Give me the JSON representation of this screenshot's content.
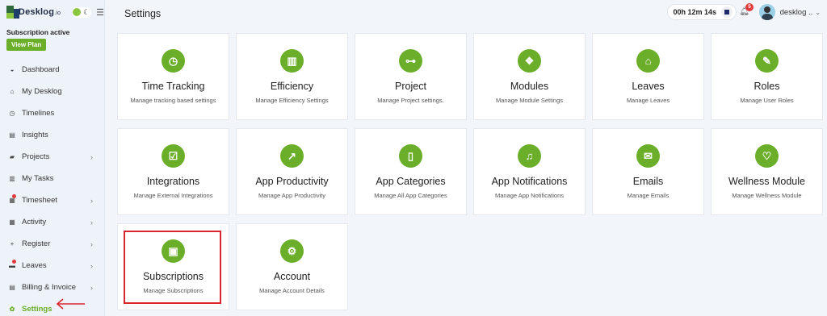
{
  "app": {
    "logo_text": "Desklog",
    "logo_suffix": ".io",
    "subscription_status": "Subscription active",
    "view_plan_label": "View Plan"
  },
  "sidebar": {
    "items": [
      {
        "label": "Dashboard",
        "icon": "dashboard-icon",
        "glyph": "◒",
        "chevron": "",
        "dot": false,
        "active": false
      },
      {
        "label": "My Desklog",
        "icon": "home-icon",
        "glyph": "⌂",
        "chevron": "",
        "dot": false,
        "active": false
      },
      {
        "label": "Timelines",
        "icon": "clock-icon",
        "glyph": "◷",
        "chevron": "",
        "dot": false,
        "active": false
      },
      {
        "label": "Insights",
        "icon": "book-icon",
        "glyph": "▤",
        "chevron": "",
        "dot": false,
        "active": false
      },
      {
        "label": "Projects",
        "icon": "folder-icon",
        "glyph": "▰",
        "chevron": "›",
        "dot": false,
        "active": false
      },
      {
        "label": "My Tasks",
        "icon": "tasks-icon",
        "glyph": "▥",
        "chevron": "",
        "dot": false,
        "active": false
      },
      {
        "label": "Timesheet",
        "icon": "timesheet-icon",
        "glyph": "▦",
        "chevron": "›",
        "dot": true,
        "active": false
      },
      {
        "label": "Activity",
        "icon": "activity-icon",
        "glyph": "▦",
        "chevron": "›",
        "dot": false,
        "active": false
      },
      {
        "label": "Register",
        "icon": "plus-icon",
        "glyph": "+",
        "chevron": "›",
        "dot": false,
        "active": false
      },
      {
        "label": "Leaves",
        "icon": "leaves-icon",
        "glyph": "▬",
        "chevron": "›",
        "dot": true,
        "active": false
      },
      {
        "label": "Billing & Invoice",
        "icon": "billing-icon",
        "glyph": "▤",
        "chevron": "›",
        "dot": false,
        "active": false
      },
      {
        "label": "Settings",
        "icon": "gear-icon",
        "glyph": "✿",
        "chevron": "",
        "dot": false,
        "active": true
      }
    ]
  },
  "header": {
    "title": "Settings",
    "timer": "00h 12m 14s",
    "notification_count": "5",
    "user_name": "desklog ..",
    "user_chevron": "⌄"
  },
  "cards": [
    {
      "title": "Time Tracking",
      "desc": "Manage tracking based settings",
      "icon": "clock-icon",
      "glyph": "◷"
    },
    {
      "title": "Efficiency",
      "desc": "Manage Efficiency Settings",
      "icon": "bar-chart-icon",
      "glyph": "▥"
    },
    {
      "title": "Project",
      "desc": "Manage Project settings.",
      "icon": "sitemap-icon",
      "glyph": "⊶"
    },
    {
      "title": "Modules",
      "desc": "Manage Module Settings",
      "icon": "cubes-icon",
      "glyph": "❖"
    },
    {
      "title": "Leaves",
      "desc": "Manage Leaves",
      "icon": "home-icon",
      "glyph": "⌂"
    },
    {
      "title": "Roles",
      "desc": "Manage User Roles",
      "icon": "wrench-icon",
      "glyph": "✎"
    },
    {
      "title": "Integrations",
      "desc": "Manage External Integrations",
      "icon": "checkbox-icon",
      "glyph": "☑"
    },
    {
      "title": "App Productivity",
      "desc": "Manage App Productivity",
      "icon": "line-chart-icon",
      "glyph": "↗"
    },
    {
      "title": "App Categories",
      "desc": "Manage All App Categories",
      "icon": "mobile-icon",
      "glyph": "▯"
    },
    {
      "title": "App Notifications",
      "desc": "Manage App Notifications",
      "icon": "bell-icon",
      "glyph": "♫"
    },
    {
      "title": "Emails",
      "desc": "Manage Emails",
      "icon": "envelope-icon",
      "glyph": "✉"
    },
    {
      "title": "Wellness Module",
      "desc": "Manage Wellness Module",
      "icon": "heart-icon",
      "glyph": "♡"
    },
    {
      "title": "Subscriptions",
      "desc": "Manage Subscriptions",
      "icon": "money-icon",
      "glyph": "▣"
    },
    {
      "title": "Account",
      "desc": "Manage Account Details",
      "icon": "cogs-icon",
      "glyph": "⚙"
    }
  ],
  "colors": {
    "accent": "#6aae2a",
    "highlight": "#d9262e",
    "badge": "#e03a3a"
  }
}
